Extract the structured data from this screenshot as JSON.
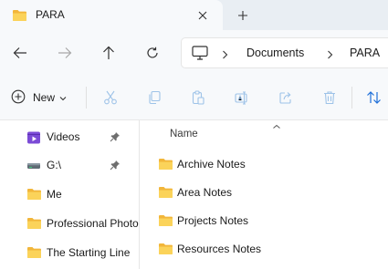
{
  "window": {
    "tab_title": "PARA",
    "tab_icon": "folder-icon",
    "close_tab_icon": "close-icon",
    "new_tab_icon": "plus-icon"
  },
  "navigation": {
    "back_icon": "arrow-left-icon",
    "forward_icon": "arrow-right-icon",
    "up_icon": "arrow-up-icon",
    "refresh_icon": "refresh-icon",
    "address": {
      "root_icon": "monitor-icon",
      "crumbs": [
        "Documents",
        "PARA"
      ]
    }
  },
  "toolbar": {
    "new_label": "New",
    "actions": [
      "cut-icon",
      "copy-icon",
      "paste-icon",
      "rename-icon",
      "share-icon",
      "delete-icon",
      "sort-icon"
    ]
  },
  "sidebar": {
    "items": [
      {
        "label": "Videos",
        "icon": "videos-icon",
        "pinned": true
      },
      {
        "label": "G:\\",
        "icon": "drive-icon",
        "pinned": true
      },
      {
        "label": "Me",
        "icon": "folder-icon",
        "pinned": false
      },
      {
        "label": "Professional Photography",
        "icon": "folder-icon",
        "pinned": false
      },
      {
        "label": "The Starting Line",
        "icon": "folder-icon",
        "pinned": false
      }
    ]
  },
  "content": {
    "column_header": "Name",
    "files": [
      {
        "label": "Archive Notes",
        "icon": "folder-icon"
      },
      {
        "label": "Area Notes",
        "icon": "folder-icon"
      },
      {
        "label": "Projects Notes",
        "icon": "folder-icon"
      },
      {
        "label": "Resources Notes",
        "icon": "folder-icon"
      }
    ]
  },
  "colors": {
    "folder": "#f7c948",
    "folder_dark": "#e5a92a",
    "videos": "#7b4bd6",
    "icon_disabled": "#9ec3e8",
    "accent": "#1e6fd9"
  }
}
